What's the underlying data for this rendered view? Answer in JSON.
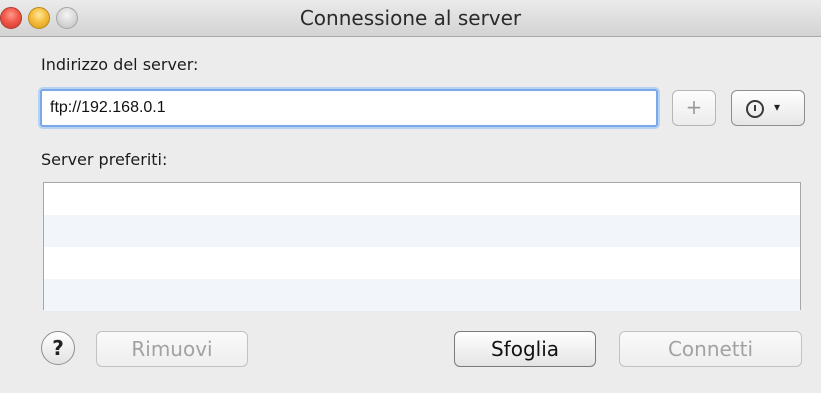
{
  "window": {
    "title": "Connessione al server"
  },
  "address": {
    "label": "Indirizzo del server:",
    "value": "ftp://192.168.0.1",
    "add_label": "+",
    "history_caret": "▾"
  },
  "favorites": {
    "label": "Server preferiti:",
    "items": []
  },
  "footer": {
    "help_label": "?",
    "remove_label": "Rimuovi",
    "browse_label": "Sfoglia",
    "connect_label": "Connetti"
  },
  "colors": {
    "focus_ring": "#7aa9e8",
    "close": "#f2584a",
    "minimize": "#f6be3c",
    "alt_row": "#f2f6fb"
  }
}
